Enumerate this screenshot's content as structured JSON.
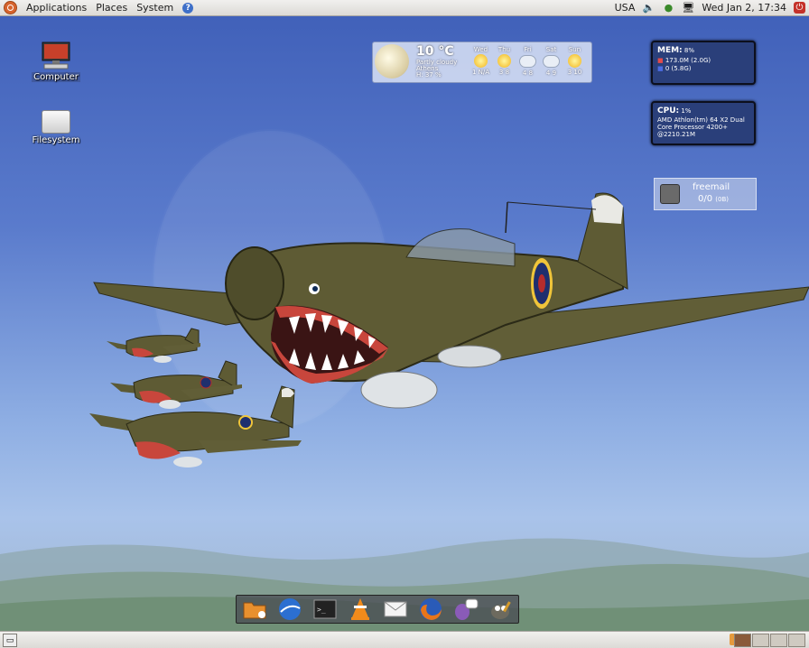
{
  "top_panel": {
    "menus": [
      "Applications",
      "Places",
      "System"
    ],
    "keyboard_layout": "USA",
    "datetime": "Wed Jan  2, 17:34"
  },
  "desktop": {
    "icons": [
      {
        "label": "Computer"
      },
      {
        "label": "Filesystem"
      }
    ]
  },
  "weather_widget": {
    "temperature": "10 °C",
    "condition": "Partly cloudy",
    "city": "Athens",
    "humidity": "H: 37 %",
    "forecast": [
      {
        "day": "Wed",
        "range": "1  N/A",
        "icon": "sun-icon"
      },
      {
        "day": "Thu",
        "range": "3  8",
        "icon": "sun-icon"
      },
      {
        "day": "Fri",
        "range": "4  8",
        "icon": "rain-cloud-icon"
      },
      {
        "day": "Sat",
        "range": "4  9",
        "icon": "cloud-icon"
      },
      {
        "day": "Sun",
        "range": "3  10",
        "icon": "sun-icon"
      }
    ]
  },
  "mem_widget": {
    "title": "MEM:",
    "percent": "8%",
    "ram_line": "173.0M (2.0G)",
    "swap_line": "0 (5.8G)"
  },
  "cpu_widget": {
    "title": "CPU:",
    "percent": "1%",
    "line1": "AMD Athlon(tm) 64 X2 Dual",
    "line2": "Core Processor 4200+",
    "line3": "@2210.21M"
  },
  "mail_widget": {
    "name": "freemail",
    "count": "0/0",
    "size": "(0B)"
  },
  "dock": {
    "items": [
      "home-folder-icon",
      "google-earth-icon",
      "terminal-icon",
      "vlc-icon",
      "mail-client-icon",
      "firefox-icon",
      "pidgin-icon",
      "gimp-icon"
    ]
  },
  "colors": {
    "sky_top": "#3f5fb8",
    "sky_bottom": "#a9c3ea",
    "panel": "#dcdad6",
    "plane_olive": "#5a5a33"
  }
}
